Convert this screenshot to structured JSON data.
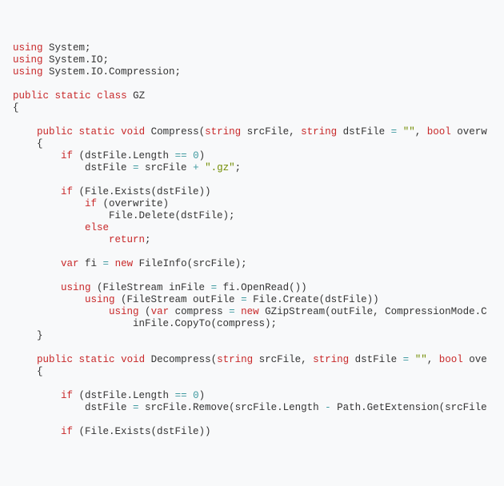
{
  "tokens": [
    [
      [
        "using",
        "kw"
      ],
      [
        " System;",
        "pl"
      ]
    ],
    [
      [
        "using",
        "kw"
      ],
      [
        " System.IO;",
        "pl"
      ]
    ],
    [
      [
        "using",
        "kw"
      ],
      [
        " System.IO.Compression;",
        "pl"
      ]
    ],
    [],
    [
      [
        "public",
        "kw"
      ],
      [
        " ",
        "pl"
      ],
      [
        "static",
        "kw"
      ],
      [
        " ",
        "pl"
      ],
      [
        "class",
        "kw"
      ],
      [
        " GZ",
        "pl"
      ]
    ],
    [
      [
        "{",
        "pl"
      ]
    ],
    [],
    [
      [
        "    ",
        "pl"
      ],
      [
        "public",
        "kw"
      ],
      [
        " ",
        "pl"
      ],
      [
        "static",
        "kw"
      ],
      [
        " ",
        "pl"
      ],
      [
        "void",
        "kw"
      ],
      [
        " Compress(",
        "pl"
      ],
      [
        "string",
        "kw"
      ],
      [
        " srcFile, ",
        "pl"
      ],
      [
        "string",
        "kw"
      ],
      [
        " dstFile ",
        "pl"
      ],
      [
        "=",
        "op"
      ],
      [
        " ",
        "pl"
      ],
      [
        "\"\"",
        "str"
      ],
      [
        ", ",
        "pl"
      ],
      [
        "bool",
        "kw"
      ],
      [
        " overw",
        "pl"
      ]
    ],
    [
      [
        "    {",
        "pl"
      ]
    ],
    [
      [
        "        ",
        "pl"
      ],
      [
        "if",
        "kw"
      ],
      [
        " (dstFile.Length ",
        "pl"
      ],
      [
        "==",
        "op"
      ],
      [
        " ",
        "pl"
      ],
      [
        "0",
        "num"
      ],
      [
        ")",
        "pl"
      ]
    ],
    [
      [
        "            dstFile ",
        "pl"
      ],
      [
        "=",
        "op"
      ],
      [
        " srcFile ",
        "pl"
      ],
      [
        "+",
        "op"
      ],
      [
        " ",
        "pl"
      ],
      [
        "\".gz\"",
        "str"
      ],
      [
        ";",
        "pl"
      ]
    ],
    [],
    [
      [
        "        ",
        "pl"
      ],
      [
        "if",
        "kw"
      ],
      [
        " (File.Exists(dstFile))",
        "pl"
      ]
    ],
    [
      [
        "            ",
        "pl"
      ],
      [
        "if",
        "kw"
      ],
      [
        " (overwrite)",
        "pl"
      ]
    ],
    [
      [
        "                File.Delete(dstFile);",
        "pl"
      ]
    ],
    [
      [
        "            ",
        "pl"
      ],
      [
        "else",
        "kw"
      ]
    ],
    [
      [
        "                ",
        "pl"
      ],
      [
        "return",
        "kw"
      ],
      [
        ";",
        "pl"
      ]
    ],
    [],
    [
      [
        "        ",
        "pl"
      ],
      [
        "var",
        "kw"
      ],
      [
        " fi ",
        "pl"
      ],
      [
        "=",
        "op"
      ],
      [
        " ",
        "pl"
      ],
      [
        "new",
        "kw2"
      ],
      [
        " FileInfo(srcFile);",
        "pl"
      ]
    ],
    [],
    [
      [
        "        ",
        "pl"
      ],
      [
        "using",
        "kw"
      ],
      [
        " (FileStream inFile ",
        "pl"
      ],
      [
        "=",
        "op"
      ],
      [
        " fi.OpenRead())",
        "pl"
      ]
    ],
    [
      [
        "            ",
        "pl"
      ],
      [
        "using",
        "kw"
      ],
      [
        " (FileStream outFile ",
        "pl"
      ],
      [
        "=",
        "op"
      ],
      [
        " File.Create(dstFile))",
        "pl"
      ]
    ],
    [
      [
        "                ",
        "pl"
      ],
      [
        "using",
        "kw"
      ],
      [
        " (",
        "pl"
      ],
      [
        "var",
        "kw"
      ],
      [
        " compress ",
        "pl"
      ],
      [
        "=",
        "op"
      ],
      [
        " ",
        "pl"
      ],
      [
        "new",
        "kw2"
      ],
      [
        " GZipStream(outFile, CompressionMode.C",
        "pl"
      ]
    ],
    [
      [
        "                    inFile.CopyTo(compress);",
        "pl"
      ]
    ],
    [
      [
        "    }",
        "pl"
      ]
    ],
    [],
    [
      [
        "    ",
        "pl"
      ],
      [
        "public",
        "kw"
      ],
      [
        " ",
        "pl"
      ],
      [
        "static",
        "kw"
      ],
      [
        " ",
        "pl"
      ],
      [
        "void",
        "kw"
      ],
      [
        " Decompress(",
        "pl"
      ],
      [
        "string",
        "kw"
      ],
      [
        " srcFile, ",
        "pl"
      ],
      [
        "string",
        "kw"
      ],
      [
        " dstFile ",
        "pl"
      ],
      [
        "=",
        "op"
      ],
      [
        " ",
        "pl"
      ],
      [
        "\"\"",
        "str"
      ],
      [
        ", ",
        "pl"
      ],
      [
        "bool",
        "kw"
      ],
      [
        " ove",
        "pl"
      ]
    ],
    [
      [
        "    {",
        "pl"
      ]
    ],
    [],
    [
      [
        "        ",
        "pl"
      ],
      [
        "if",
        "kw"
      ],
      [
        " (dstFile.Length ",
        "pl"
      ],
      [
        "==",
        "op"
      ],
      [
        " ",
        "pl"
      ],
      [
        "0",
        "num"
      ],
      [
        ")",
        "pl"
      ]
    ],
    [
      [
        "            dstFile ",
        "pl"
      ],
      [
        "=",
        "op"
      ],
      [
        " srcFile.Remove(srcFile.Length ",
        "pl"
      ],
      [
        "-",
        "op"
      ],
      [
        " Path.GetExtension(srcFile",
        "pl"
      ]
    ],
    [],
    [
      [
        "        ",
        "pl"
      ],
      [
        "if",
        "kw"
      ],
      [
        " (File.Exists(dstFile))",
        "pl"
      ]
    ]
  ]
}
